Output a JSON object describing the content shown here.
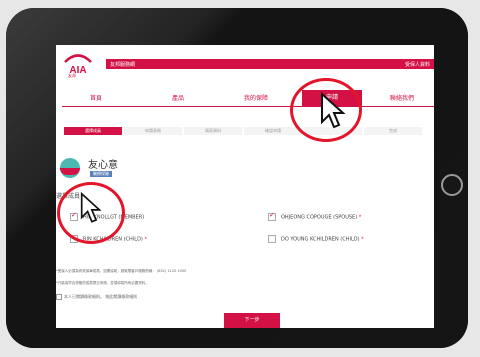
{
  "header": {
    "logo_text": "AIA",
    "logo_sub": "友邦",
    "bar_left": "友邦服務網",
    "bar_right": "受保人資料"
  },
  "nav": {
    "items": [
      {
        "label": "首頁"
      },
      {
        "label": "產品"
      },
      {
        "label": "我的保障"
      },
      {
        "label": "申請"
      },
      {
        "label": "聯絡我們"
      }
    ],
    "active_index": 3
  },
  "steps": [
    {
      "label": "選擇成員"
    },
    {
      "label": "申請表格"
    },
    {
      "label": "填寫資料"
    },
    {
      "label": "確認申請"
    },
    {
      "label": ""
    },
    {
      "label": "完成"
    }
  ],
  "plan": {
    "name": "友心意",
    "tag": "醫療保險"
  },
  "section_title": "選擇成員",
  "members": [
    {
      "label": "HIN  KNOLLGT (MEMBER)",
      "checked": true,
      "required": false
    },
    {
      "label": "OHJEONG COPOUGE (SPOUSE)",
      "checked": true,
      "required": true
    },
    {
      "label": "RIN  KCHILDREN (CHILD)",
      "checked": false,
      "required": true
    },
    {
      "label": "DO YOUNG KCHILDREN (CHILD)",
      "checked": false,
      "required": true
    }
  ],
  "notes": [
    "*受保人必須為有效保單成員，如需協助，請致電客戶服務熱線： (852) 1120 1000",
    "*只能為符合資格的成員提交申請，並須填寫所有必要資料。"
  ],
  "agree_text": "本人已閱讀條款細則。",
  "agree_link": "按此閱讀條款細則",
  "next_label": "下一步",
  "colors": {
    "brand": "#d31145",
    "annotation": "#e3152b"
  }
}
